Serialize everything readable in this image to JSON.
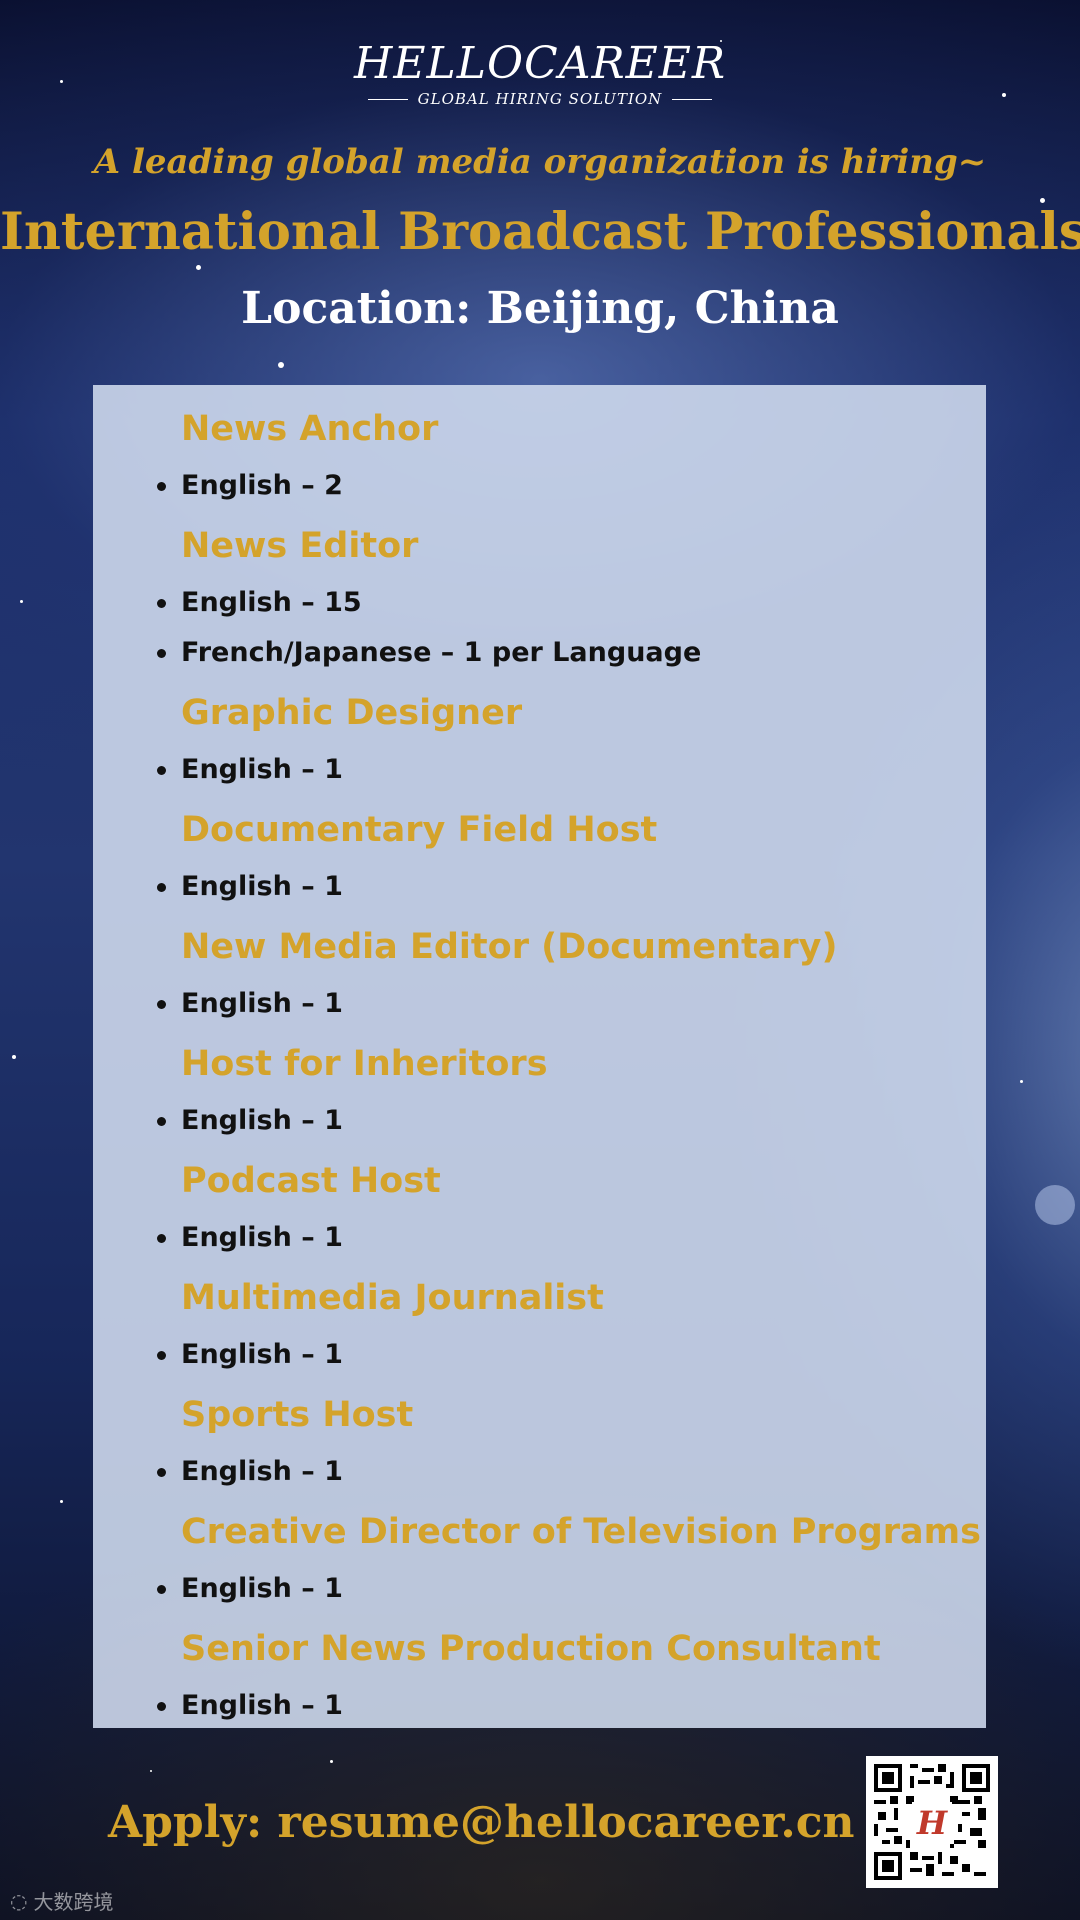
{
  "logo": {
    "main": "HELLOCAREER",
    "sub": "GLOBAL HIRING SOLUTION",
    "qr_mark": "H"
  },
  "subheadline": "A leading global media organization is hiring~",
  "headline": "International Broadcast Professionals",
  "location": "Location: Beijing, China",
  "jobs": [
    {
      "title": "News Anchor",
      "openings": [
        "English – 2"
      ]
    },
    {
      "title": "News Editor",
      "openings": [
        "English – 15",
        "French/Japanese – 1 per Language"
      ]
    },
    {
      "title": "Graphic Designer",
      "openings": [
        "English – 1"
      ]
    },
    {
      "title": "Documentary Field Host",
      "openings": [
        "English – 1"
      ]
    },
    {
      "title": "New Media Editor (Documentary)",
      "openings": [
        "English – 1"
      ]
    },
    {
      "title": "Host for Inheritors",
      "openings": [
        "English – 1"
      ]
    },
    {
      "title": "Podcast Host",
      "openings": [
        "English – 1"
      ]
    },
    {
      "title": "Multimedia Journalist",
      "openings": [
        "English – 1"
      ]
    },
    {
      "title": "Sports Host",
      "openings": [
        "English – 1"
      ]
    },
    {
      "title": "Creative Director of Television Programs",
      "openings": [
        "English – 1"
      ]
    },
    {
      "title": "Senior News Production Consultant",
      "openings": [
        "English – 1"
      ]
    }
  ],
  "apply": "Apply: resume@hellocareer.cn",
  "watermark": "大数跨境",
  "colors": {
    "gold": "#d4a32b",
    "panel": "#cdd8ec",
    "text_dark": "#111111"
  }
}
